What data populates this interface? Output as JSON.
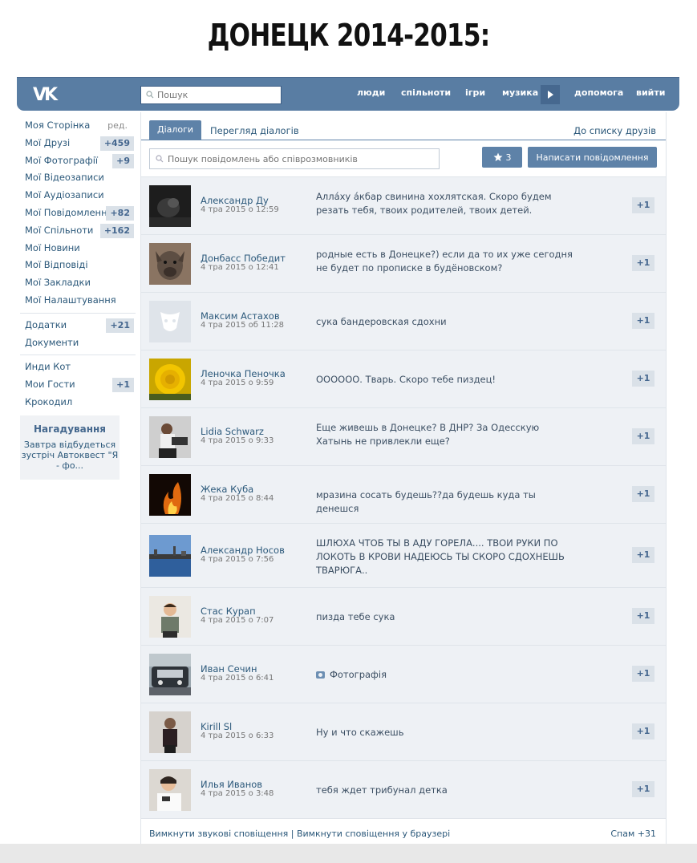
{
  "caption": "ДОНЕЦК 2014-2015:",
  "topbar": {
    "logo": "VK",
    "search_placeholder": "Пошук",
    "nav": [
      "люди",
      "спільноти",
      "ігри",
      "музика",
      "допомога",
      "вийти"
    ],
    "accent": "#597da3"
  },
  "sidebar": {
    "items": [
      {
        "label": "Моя Сторінка",
        "extra": "ред."
      },
      {
        "label": "Мої Друзі",
        "badge": "+459"
      },
      {
        "label": "Мої Фотографії",
        "badge": "+9"
      },
      {
        "label": "Мої Відеозаписи"
      },
      {
        "label": "Мої Аудіозаписи"
      },
      {
        "label": "Мої Повідомлення",
        "badge": "+82"
      },
      {
        "label": "Мої Спільноти",
        "badge": "+162"
      },
      {
        "label": "Мої Новини"
      },
      {
        "label": "Мої Відповіді"
      },
      {
        "label": "Мої Закладки"
      },
      {
        "label": "Мої Налаштування"
      }
    ],
    "apps": [
      {
        "label": "Додатки",
        "badge": "+21"
      },
      {
        "label": "Документи"
      }
    ],
    "extra": [
      {
        "label": "Инди Кот"
      },
      {
        "label": "Мои Гости",
        "badge": "+1"
      },
      {
        "label": "Крокодил"
      }
    ],
    "reminder": {
      "title": "Нагадування",
      "body": "Завтра відбудеться зустріч Автоквест \"Я - фо..."
    }
  },
  "main": {
    "tabs": {
      "active": "Діалоги",
      "view": "Перегляд діалогів",
      "friends": "До списку друзів"
    },
    "search_placeholder": "Пошук повідомлень або співрозмовників",
    "star_count": "3",
    "write_button": "Написати повідомлення",
    "dialogs": [
      {
        "name": "Александр Ду",
        "date": "4 тра 2015 о 12:59",
        "text": "Аллáху áкбар свинина хохлятская. Скоро будем резать тебя, твоих родителей, твоих детей.",
        "badge": "+1",
        "avatar": "dark-dog"
      },
      {
        "name": "Донбасс Победит",
        "date": "4 тра 2015 о 12:41",
        "text": "родные есть в Донецке?) если да то их уже сегодня не будет по прописке в будёновском?",
        "badge": "+1",
        "avatar": "pitbull"
      },
      {
        "name": "Максим Астахов",
        "date": "4 тра 2015 об 11:28",
        "text": "сука бандеровская сдохни",
        "badge": "+1",
        "avatar": "default"
      },
      {
        "name": "Леночка Пеночка",
        "date": "4 тра 2015 о 9:59",
        "text": "ОООООО. Тварь. Скоро тебе пиздец!",
        "badge": "+1",
        "avatar": "yellow-rose"
      },
      {
        "name": "Lidia Schwarz",
        "date": "4 тра 2015 о 9:33",
        "text": "Еще живешь в Донецке? В ДНР? За Одесскую Хатынь не привлекли еще?",
        "badge": "+1",
        "avatar": "woman"
      },
      {
        "name": "Жека Куба",
        "date": "4 тра 2015 о 8:44",
        "text": "мразина сосать будешь??да будешь куда ты денешся",
        "badge": "+1",
        "avatar": "fire"
      },
      {
        "name": "Александр Носов",
        "date": "4 тра 2015 о 7:56",
        "text": "ШЛЮХА ЧТОБ ТЫ В АДУ ГОРЕЛА.... ТВОИ РУКИ ПО ЛОКОТЬ В КРОВИ НАДЕЮСЬ ТЫ СКОРО СДОХНЕШЬ ТВАРЮГА..",
        "badge": "+1",
        "avatar": "river"
      },
      {
        "name": "Стас Курап",
        "date": "4 тра 2015 о 7:07",
        "text": "пизда тебе сука",
        "badge": "+1",
        "avatar": "boy"
      },
      {
        "name": "Иван Сечин",
        "date": "4 тра 2015 о 6:41",
        "text": "Фотографія",
        "badge": "+1",
        "avatar": "car",
        "photo": true
      },
      {
        "name": "Kirill Sl",
        "date": "4 тра 2015 о 6:33",
        "text": "Ну и что скажешь",
        "badge": "+1",
        "avatar": "man-dark"
      },
      {
        "name": "Илья Иванов",
        "date": "4 тра 2015 о 3:48",
        "text": "тебя ждет трибунал детка",
        "badge": "+1",
        "avatar": "teen"
      }
    ],
    "footer_left": "Вимкнути звукові сповіщення | Вимкнути сповіщення у браузері",
    "footer_right": "Спам +31"
  }
}
